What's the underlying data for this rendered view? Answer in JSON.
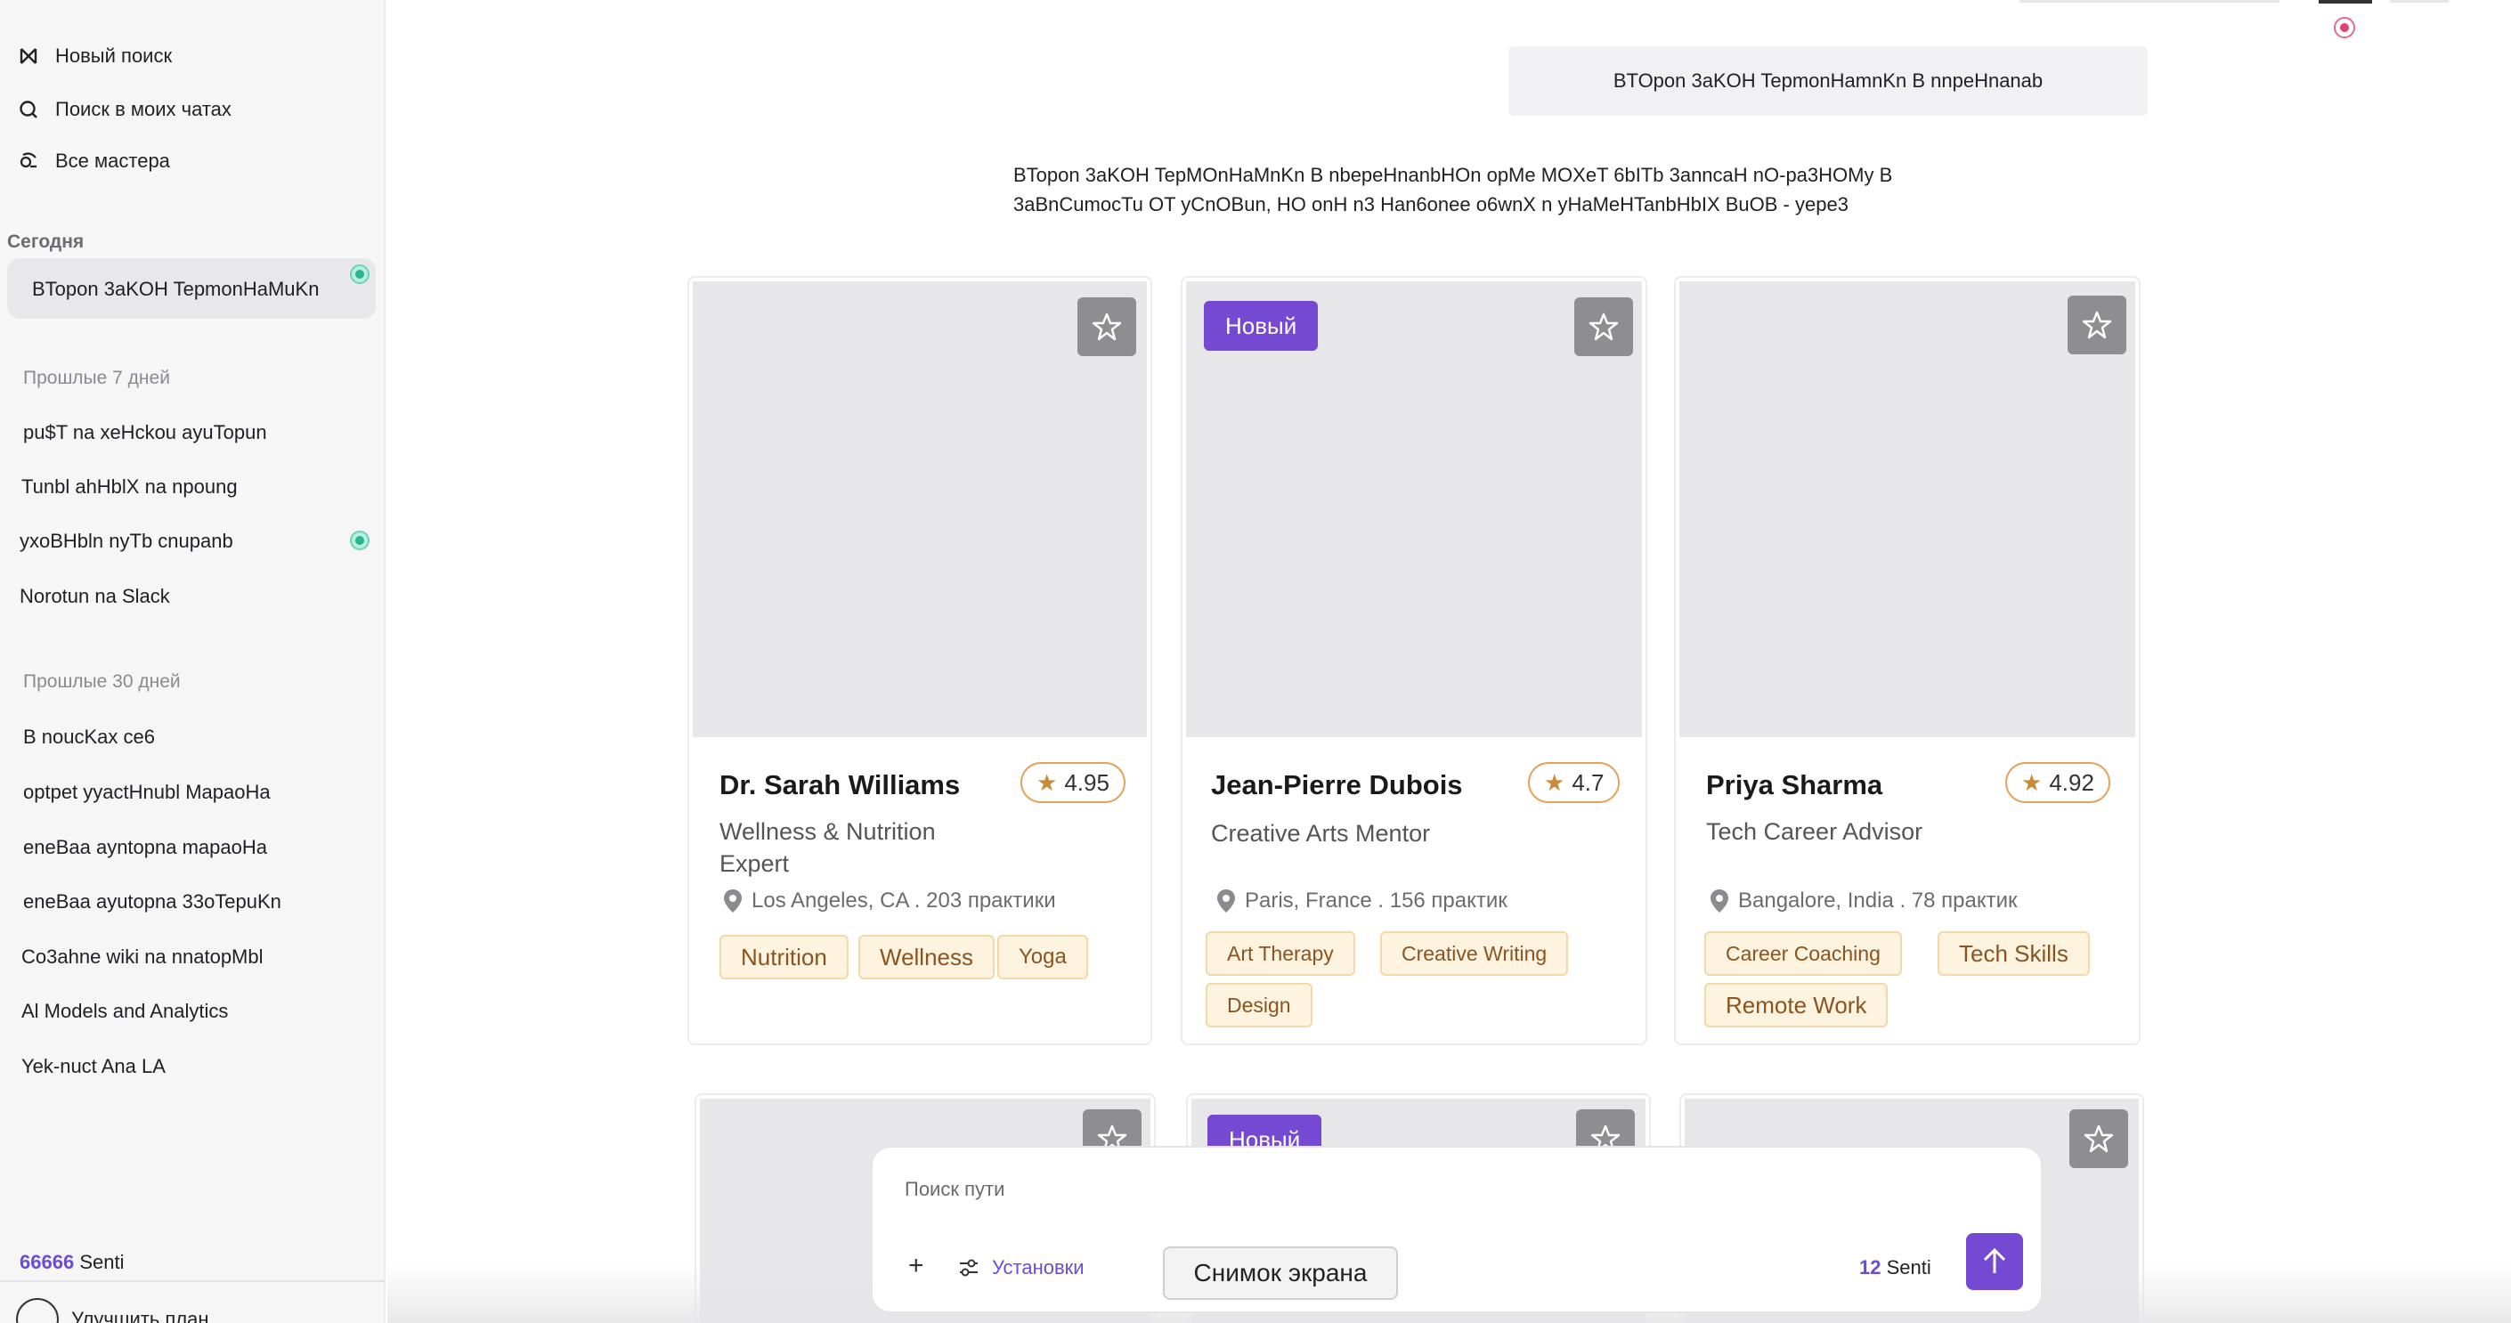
{
  "sidebar": {
    "new_search": "Новый поиск",
    "search_chats": "Поиск в моих чатах",
    "all_masters": "Все мастера",
    "today_label": "Сегодня",
    "today_items": [
      "BTopon 3aKOH TepmonHaMuKn"
    ],
    "past7_label": "Прошлые 7 дней",
    "past7_items": [
      "pu$T na xeHckou ayuTopun",
      "Tunbl ahHblX na npoung",
      "yxoBHbln nyTb  cnupanb",
      "Norotun na Slack"
    ],
    "past30_label": "Прошлые 30 дней",
    "past30_items": [
      "B noucKax ce6",
      "optpet yyactHnubl MapaoHa",
      "eneBaa ayntopna mapaoHa",
      "eneBaa ayutopna 33oTepuKn",
      "Co3ahne wiki na nnatopMbl",
      "Al Models and Analytics",
      "Yek-nuct Ana LA"
    ],
    "credits_num": "66666",
    "credits_unit": "Senti",
    "upgrade": "Улучшить план"
  },
  "chat": {
    "query": "BTOpon 3aKOH TepmonHamnKn B nnpeHnanab",
    "answer": "BTopon 3aKOH TepMOnHaMnKn B nbepeHnanbHOn opMe MOXeT 6bITb 3anncaH nO-pa3HOMy B 3aBnCumocTu OT yCnOBun, HO onH n3 Han6onee o6wnX n yHaMeHTanbHbIX BuOB - yepe3"
  },
  "cards": [
    {
      "name": "Dr. Sarah Williams",
      "rating": "4.95",
      "role": "Wellness & Nutrition Expert",
      "location": "Los Angeles, CA . 203 практики",
      "tags": [
        "Nutrition",
        "Wellness",
        "Yoga"
      ],
      "badge": ""
    },
    {
      "name": "Jean-Pierre Dubois",
      "rating": "4.7",
      "role": "Creative Arts Mentor",
      "location": "Paris, France . 156 практик",
      "tags": [
        "Art Therapy",
        "Creative Writing",
        "Design"
      ],
      "badge": "Новый"
    },
    {
      "name": "Priya Sharma",
      "rating": "4.92",
      "role": "Tech Career Advisor",
      "location": "Bangalore, India . 78 практик",
      "tags": [
        "Career Coaching",
        "Tech Skills",
        "Remote Work"
      ],
      "badge": ""
    }
  ],
  "second_row_badge": "Новый",
  "input": {
    "placeholder": "Поиск пути",
    "settings_label": "Установки",
    "senti_num": "12",
    "senti_unit": "Senti"
  },
  "tooltip": "Снимок экрана",
  "colors": {
    "accent": "#7649d3",
    "tag_bg": "#fdf3de",
    "rating_border": "#e0a35a",
    "teal": "#2bb48f"
  }
}
